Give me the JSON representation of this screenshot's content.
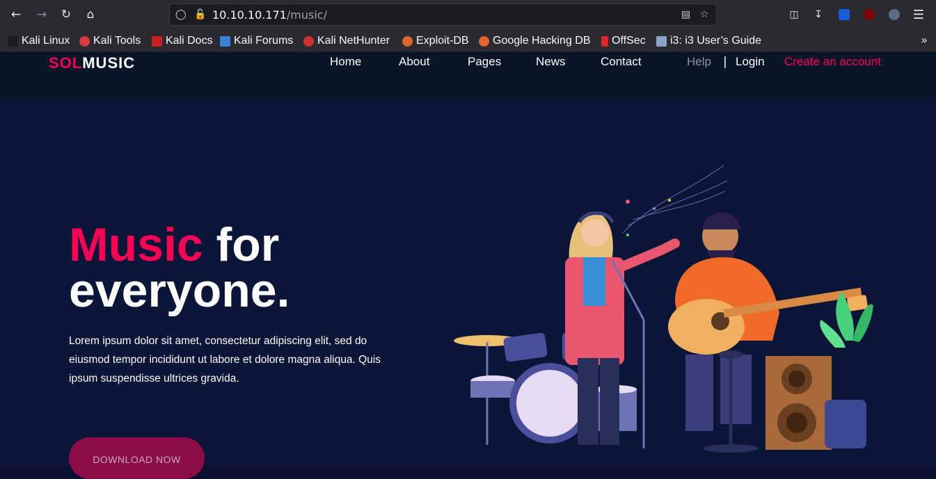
{
  "browser": {
    "url_host": "10.10.10.171",
    "url_path": "/music/",
    "bookmarks": [
      {
        "label": "Kali Linux",
        "color": "#1d1d1d"
      },
      {
        "label": "Kali Tools",
        "color": "#d63a3a"
      },
      {
        "label": "Kali Docs",
        "color": "#c91f1f"
      },
      {
        "label": "Kali Forums",
        "color": "#3b82d6"
      },
      {
        "label": "Kali NetHunter",
        "color": "#d23030"
      },
      {
        "label": "Exploit-DB",
        "color": "#e0652a"
      },
      {
        "label": "Google Hacking DB",
        "color": "#e0652a"
      },
      {
        "label": "OffSec",
        "color": "#e2262c"
      },
      {
        "label": "i3: i3 User’s Guide",
        "color": "#8aa3c8"
      }
    ]
  },
  "site": {
    "logo_sol": "SOL",
    "logo_music": "MUSIC",
    "menu": {
      "home": "Home",
      "about": "About",
      "pages": "Pages",
      "news": "News",
      "contact": "Contact",
      "help": "Help",
      "separator": "|",
      "login": "Login",
      "create_account": "Create an account"
    },
    "hero": {
      "title_accent": "Music",
      "title_rest": " for",
      "title_line2": "everyone.",
      "text": "Lorem ipsum dolor sit amet, consectetur adipiscing elit, sed do eiusmod tempor incididunt ut labore et dolore magna aliqua. Quis ipsum suspendisse ultrices gravida.",
      "button": "DOWNLOAD NOW"
    },
    "colors": {
      "accent": "#fc0254",
      "background": "#0b1537",
      "header": "#081427"
    }
  }
}
